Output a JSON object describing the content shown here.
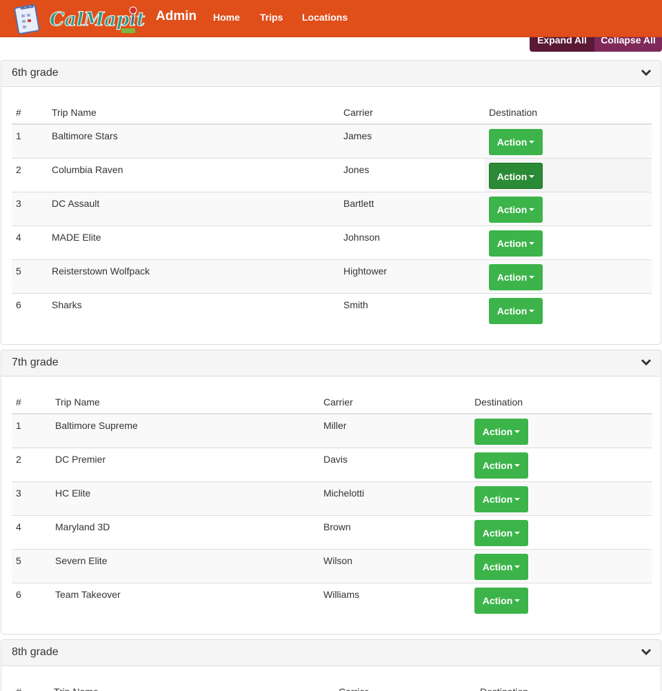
{
  "nav": {
    "brand": "Admin",
    "links": [
      "Home",
      "Trips",
      "Locations"
    ]
  },
  "toolbar": {
    "expand_label": "Expand All",
    "collapse_label": "Collapse All"
  },
  "colors": {
    "navbar": "#e04e1a",
    "action_button": "#3cb44a",
    "action_button_active": "#2b8a35",
    "expand_button": "#5a1a36",
    "collapse_button": "#7f2a5b"
  },
  "panels": [
    {
      "title": "6th grade",
      "columns": [
        "#",
        "Trip Name",
        "Carrier",
        "Destination"
      ],
      "rows": [
        {
          "num": "1",
          "trip": "Baltimore Stars",
          "carrier": "James",
          "action": "Action"
        },
        {
          "num": "2",
          "trip": "Columbia Raven",
          "carrier": "Jones",
          "action": "Action"
        },
        {
          "num": "3",
          "trip": "DC Assault",
          "carrier": "Bartlett",
          "action": "Action"
        },
        {
          "num": "4",
          "trip": "MADE Elite",
          "carrier": "Johnson",
          "action": "Action"
        },
        {
          "num": "5",
          "trip": "Reisterstown Wolfpack",
          "carrier": "Hightower",
          "action": "Action"
        },
        {
          "num": "6",
          "trip": "Sharks",
          "carrier": "Smith",
          "action": "Action"
        }
      ]
    },
    {
      "title": "7th grade",
      "columns": [
        "#",
        "Trip Name",
        "Carrier",
        "Destination"
      ],
      "rows": [
        {
          "num": "1",
          "trip": "Baltimore Supreme",
          "carrier": "Miller",
          "action": "Action"
        },
        {
          "num": "2",
          "trip": "DC Premier",
          "carrier": "Davis",
          "action": "Action"
        },
        {
          "num": "3",
          "trip": "HC Elite",
          "carrier": "Michelotti",
          "action": "Action"
        },
        {
          "num": "4",
          "trip": "Maryland 3D",
          "carrier": "Brown",
          "action": "Action"
        },
        {
          "num": "5",
          "trip": "Severn Elite",
          "carrier": "Wilson",
          "action": "Action"
        },
        {
          "num": "6",
          "trip": "Team Takeover",
          "carrier": "Williams",
          "action": "Action"
        }
      ]
    },
    {
      "title": "8th grade",
      "columns": [
        "#",
        "Trip Name",
        "Carrier",
        "Destination"
      ],
      "rows": []
    }
  ]
}
